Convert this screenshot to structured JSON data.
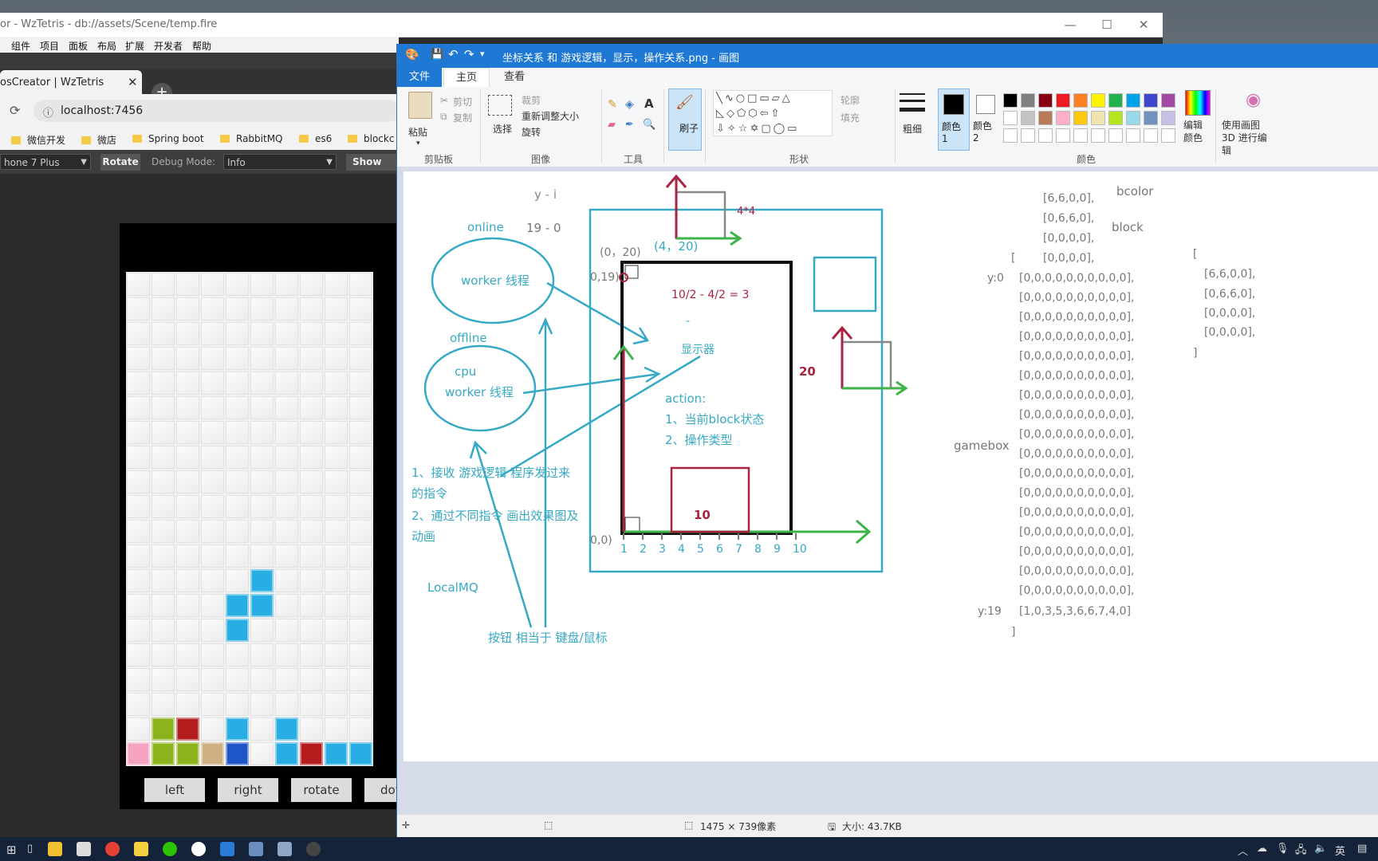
{
  "creator": {
    "title": "or - WzTetris - db://assets/Scene/temp.fire",
    "menu": [
      "组件",
      "项目",
      "面板",
      "布局",
      "扩展",
      "开发者",
      "帮助"
    ],
    "tab_label": "osCreator | WzTetris",
    "tab_close": "✕",
    "tab_new": "+",
    "url": "localhost:7456",
    "bookmarks": [
      "微信开发",
      "微店",
      "Spring boot",
      "RabbitMQ",
      "es6",
      "blockc"
    ],
    "device_select": "hone 7 Plus",
    "rotate_label": "Rotate",
    "debug_mode_label": "Debug Mode:",
    "debug_mode_value": "Info",
    "show_fps_label": "Show FPS",
    "game_buttons": [
      "left",
      "right",
      "rotate",
      "dov"
    ]
  },
  "board": {
    "cols": 10,
    "rows": 20,
    "colors": {
      "cyan": "#29aee3",
      "green": "#8cb31d",
      "red": "#b41d1d",
      "pink": "#f4a4c0",
      "tan": "#cfb083",
      "blue": "#1e56c8"
    },
    "blocks": [
      {
        "col": 5,
        "row": 12,
        "color": "cyan"
      },
      {
        "col": 4,
        "row": 13,
        "color": "cyan"
      },
      {
        "col": 5,
        "row": 13,
        "color": "cyan"
      },
      {
        "col": 4,
        "row": 14,
        "color": "cyan"
      },
      {
        "col": 1,
        "row": 18,
        "color": "green"
      },
      {
        "col": 2,
        "row": 18,
        "color": "red"
      },
      {
        "col": 4,
        "row": 18,
        "color": "cyan"
      },
      {
        "col": 6,
        "row": 18,
        "color": "cyan"
      },
      {
        "col": 0,
        "row": 19,
        "color": "pink"
      },
      {
        "col": 1,
        "row": 19,
        "color": "green"
      },
      {
        "col": 2,
        "row": 19,
        "color": "green"
      },
      {
        "col": 3,
        "row": 19,
        "color": "tan"
      },
      {
        "col": 4,
        "row": 19,
        "color": "blue"
      },
      {
        "col": 6,
        "row": 19,
        "color": "cyan"
      },
      {
        "col": 7,
        "row": 19,
        "color": "red"
      },
      {
        "col": 8,
        "row": 19,
        "color": "cyan"
      },
      {
        "col": 9,
        "row": 19,
        "color": "cyan"
      }
    ]
  },
  "paint": {
    "title": "坐标关系 和 游戏逻辑，显示，操作关系.png - 画图",
    "tabs": {
      "file": "文件",
      "home": "主页",
      "view": "查看"
    },
    "ribbon": {
      "paste": "粘贴",
      "cut": "剪切",
      "copy": "复制",
      "clipboard": "剪贴板",
      "select": "选择",
      "crop": "裁剪",
      "resize": "重新调整大小",
      "rotate": "旋转",
      "image": "图像",
      "tools": "工具",
      "brush": "刷子",
      "outline": "轮廓",
      "fill": "填充",
      "shapes": "形状",
      "size": "粗细",
      "color1": "颜色 1",
      "color2": "颜色 2",
      "edit_colors": "编辑颜色",
      "paint3d": "使用画图 3D 进行编辑",
      "colors": "颜色"
    },
    "palette": [
      "#000000",
      "#7f7f7f",
      "#880015",
      "#ed1c24",
      "#ff7f27",
      "#fff200",
      "#22b14c",
      "#00a2e8",
      "#3f48cc",
      "#a349a4",
      "#ffffff",
      "#c3c3c3",
      "#b97a57",
      "#ffaec9",
      "#ffc90e",
      "#efe4b0",
      "#b5e61d",
      "#99d9ea",
      "#7092be",
      "#c8bfe7"
    ],
    "status": {
      "dimensions": "1475 × 739像素",
      "size": "大小: 43.7KB"
    }
  },
  "drawing": {
    "yi": "y - i",
    "range": "19 - 0",
    "online": "online",
    "worker_thread": "worker 线程",
    "offline": "offline",
    "cpu": "cpu",
    "cpu_worker": "worker 线程",
    "coord_top": "(0，20)",
    "coord_block": "(4，20)",
    "coord_019": "0,19)",
    "coord_00": "0,0)",
    "size44": "4*4",
    "formula": "10/2 - 4/2 = 3",
    "dash": "-",
    "display": "显示器",
    "height20": "20",
    "action_title": "action:",
    "action1": "1、当前block状态",
    "action2": "2、操作类型",
    "width10": "10",
    "x_ticks": [
      "1",
      "2",
      "3",
      "4",
      "5",
      "6",
      "7",
      "8",
      "9",
      "10"
    ],
    "note1a": "1、接收 游戏逻辑 程序发过来",
    "note1b": "的指令",
    "note2a": "2、通过不同指令 画出效果图及",
    "note2b": "动画",
    "localmq": "LocalMQ",
    "buttons": "按钮 相当于 键盘/鼠标",
    "bcolor": "bcolor",
    "block": "block",
    "gamebox": "gamebox",
    "y0": "y:0",
    "y19": "y:19",
    "block_rows": [
      "[6,6,0,0],",
      "[0,6,6,0],",
      "[0,0,0,0],",
      "[0,0,0,0],"
    ],
    "open_bracket": "[",
    "close_bracket": "]",
    "gamebox_row": "[0,0,0,0,0,0,0,0,0,0],",
    "gamebox_last": "[1,0,3,5,3,6,6,7,4,0]",
    "right_rows": [
      "[6,6,0,0],",
      "[0,6,6,0],",
      "[0,0,0,0],",
      "[0,0,0,0],"
    ]
  },
  "taskbar": {
    "tray": "英"
  }
}
